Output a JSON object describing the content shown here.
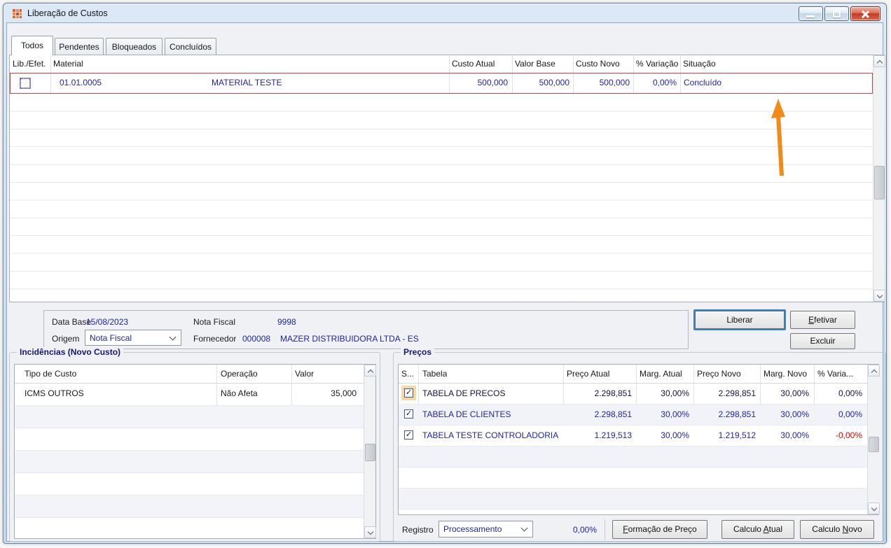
{
  "colors": {
    "navy_text": "#2323aa",
    "negative_red": "#e60000",
    "row_highlight_border": "#cf4444",
    "arrow_orange": "#f18a18",
    "titlebar_blue": "#cddff1"
  },
  "window": {
    "title": "Liberação de Custos"
  },
  "tabs": {
    "items": [
      "Todos",
      "Pendentes",
      "Bloqueados",
      "Concluídos"
    ],
    "active": "Todos"
  },
  "grid": {
    "columns": [
      "Lib./Efet.",
      "Material",
      "Custo Atual",
      "Valor Base",
      "Custo Novo",
      "% Variação",
      "Situação"
    ],
    "row": {
      "checked": false,
      "material_code": "01.01.0005",
      "material_desc": "MATERIAL TESTE",
      "custo_atual": "500,000",
      "valor_base": "500,000",
      "custo_novo": "500,000",
      "variacao": "0,00%",
      "situacao": "Concluído"
    }
  },
  "details": {
    "data_base_label": "Data Base",
    "data_base": "15/08/2023",
    "nota_fiscal_label": "Nota Fiscal",
    "nota_fiscal": "9998",
    "origem_label": "Origem",
    "origem": "Nota Fiscal",
    "fornecedor_label": "Fornecedor",
    "fornecedor_code": "000008",
    "fornecedor_name": "MAZER DISTRIBUIDORA LTDA - ES"
  },
  "actions": {
    "liberar": {
      "accel": "L",
      "rest": "iberar"
    },
    "efetivar": {
      "accel": "E",
      "rest": "fetivar"
    },
    "excluir": {
      "label": "Excluir"
    }
  },
  "incidencias": {
    "title": "Incidências (Novo Custo)",
    "columns": [
      "Tipo de Custo",
      "Operação",
      "Valor"
    ],
    "rows": [
      {
        "tipo": "ICMS OUTROS",
        "operacao": "Não Afeta",
        "valor": "35,000"
      }
    ]
  },
  "precos": {
    "title": "Preços",
    "columns": [
      "S...",
      "Tabela",
      "Preço Atual",
      "Marg. Atual",
      "Preço Novo",
      "Marg. Novo",
      "% Varia..."
    ],
    "rows": [
      {
        "checked": true,
        "tabela": "TABELA DE PRECOS",
        "preco_atual": "2.298,851",
        "marg_atual": "30,00%",
        "preco_novo": "2.298,851",
        "marg_novo": "30,00%",
        "variacao": "0,00%"
      },
      {
        "checked": true,
        "tabela": "TABELA DE CLIENTES",
        "preco_atual": "2.298,851",
        "marg_atual": "30,00%",
        "preco_novo": "2.298,851",
        "marg_novo": "30,00%",
        "variacao": "0,00%"
      },
      {
        "checked": true,
        "tabela": "TABELA TESTE CONTROLADORIA",
        "preco_atual": "1.219,513",
        "marg_atual": "30,00%",
        "preco_novo": "1.219,512",
        "marg_novo": "30,00%",
        "variacao": "-0,00%"
      }
    ]
  },
  "footer": {
    "registro_label": "Registro",
    "registro_value": "Processamento",
    "percent": "0,00%",
    "formacao": {
      "accel": "F",
      "rest": "ormação de Preço"
    },
    "calculo_atual": {
      "pre": "Calculo ",
      "accel": "A",
      "rest": "tual"
    },
    "calculo_novo": {
      "pre": "Calculo ",
      "accel": "N",
      "rest": "ovo"
    }
  }
}
